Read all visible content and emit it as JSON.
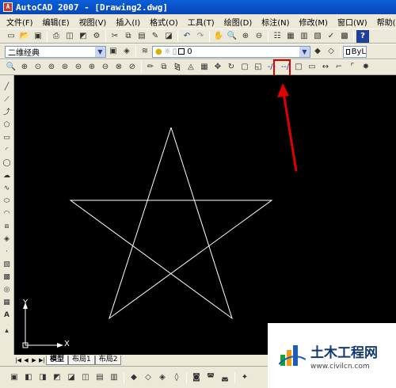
{
  "window": {
    "title": "AutoCAD 2007 - [Drawing2.dwg]"
  },
  "menu": [
    "文件(F)",
    "编辑(E)",
    "视图(V)",
    "插入(I)",
    "格式(O)",
    "工具(T)",
    "绘图(D)",
    "标注(N)",
    "修改(M)",
    "窗口(W)",
    "帮助(H)"
  ],
  "workspace_combo": {
    "value": "二维经典"
  },
  "layer_combo": {
    "value": "0"
  },
  "linetype_combo": {
    "value": "ByL"
  },
  "tabs": [
    "模型",
    "布局1",
    "布局2"
  ],
  "ucs": {
    "x_label": "X",
    "y_label": "Y"
  },
  "watermark": {
    "title": "土木工程网",
    "url": "www.civilcn.com"
  },
  "colors": {
    "titlebar": "#0a5fd9",
    "canvas": "#000000",
    "highlight": "#e00000",
    "star_stroke": "#ffffff"
  }
}
